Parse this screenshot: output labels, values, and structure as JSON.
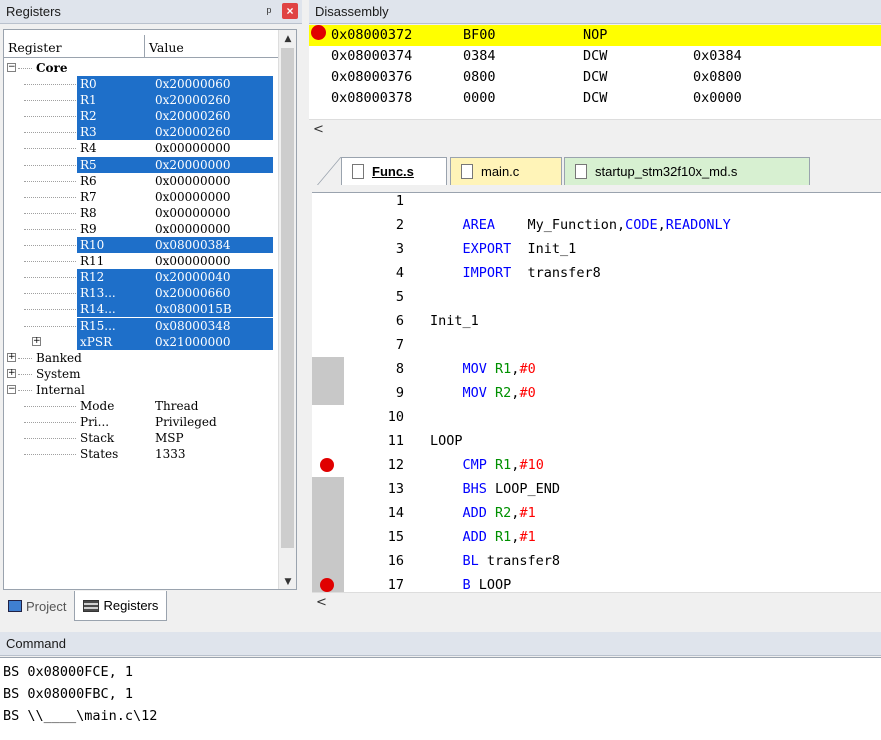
{
  "registers_panel": {
    "title": "Registers",
    "pin_icon": "pin-icon",
    "close_label": "×",
    "columns": [
      "Register",
      "Value"
    ],
    "rows": [
      {
        "name": "Core",
        "value": "",
        "level": 0,
        "expander": "−",
        "bold": true,
        "selected": false
      },
      {
        "name": "R0",
        "value": "0x20000060",
        "level": 1,
        "expander": "",
        "selected": true
      },
      {
        "name": "R1",
        "value": "0x20000260",
        "level": 1,
        "expander": "",
        "selected": true
      },
      {
        "name": "R2",
        "value": "0x20000260",
        "level": 1,
        "expander": "",
        "selected": true
      },
      {
        "name": "R3",
        "value": "0x20000260",
        "level": 1,
        "expander": "",
        "selected": true
      },
      {
        "name": "R4",
        "value": "0x00000000",
        "level": 1,
        "expander": "",
        "selected": false
      },
      {
        "name": "R5",
        "value": "0x20000000",
        "level": 1,
        "expander": "",
        "selected": true
      },
      {
        "name": "R6",
        "value": "0x00000000",
        "level": 1,
        "expander": "",
        "selected": false
      },
      {
        "name": "R7",
        "value": "0x00000000",
        "level": 1,
        "expander": "",
        "selected": false
      },
      {
        "name": "R8",
        "value": "0x00000000",
        "level": 1,
        "expander": "",
        "selected": false
      },
      {
        "name": "R9",
        "value": "0x00000000",
        "level": 1,
        "expander": "",
        "selected": false
      },
      {
        "name": "R10",
        "value": "0x08000384",
        "level": 1,
        "expander": "",
        "selected": true
      },
      {
        "name": "R11",
        "value": "0x00000000",
        "level": 1,
        "expander": "",
        "selected": false
      },
      {
        "name": "R12",
        "value": "0x20000040",
        "level": 1,
        "expander": "",
        "selected": true
      },
      {
        "name": "R13...",
        "value": "0x20000660",
        "level": 1,
        "expander": "",
        "selected": true
      },
      {
        "name": "R14...",
        "value": "0x0800015B",
        "level": 1,
        "expander": "",
        "selected": true
      },
      {
        "name": "R15...",
        "value": "0x08000348",
        "level": 1,
        "expander": "",
        "selected": true
      },
      {
        "name": "xPSR",
        "value": "0x21000000",
        "level": 1,
        "expander": "+",
        "selected": true
      },
      {
        "name": "Banked",
        "value": "",
        "level": 0,
        "expander": "+",
        "selected": false
      },
      {
        "name": "System",
        "value": "",
        "level": 0,
        "expander": "+",
        "selected": false
      },
      {
        "name": "Internal",
        "value": "",
        "level": 0,
        "expander": "−",
        "selected": false
      },
      {
        "name": "Mode",
        "value": "Thread",
        "level": 1,
        "expander": "",
        "selected": false
      },
      {
        "name": "Pri...",
        "value": "Privileged",
        "level": 1,
        "expander": "",
        "selected": false
      },
      {
        "name": "Stack",
        "value": "MSP",
        "level": 1,
        "expander": "",
        "selected": false
      },
      {
        "name": "States",
        "value": "1333",
        "level": 1,
        "expander": "",
        "selected": false
      }
    ],
    "tabs": [
      {
        "label": "Project",
        "icon": "project-icon",
        "active": false
      },
      {
        "label": "Registers",
        "icon": "registers-icon",
        "active": true
      }
    ]
  },
  "disassembly": {
    "title": "Disassembly",
    "rows": [
      {
        "addr": "0x08000372",
        "code": "BF00",
        "mnemonic": "NOP",
        "operand": "",
        "current": true,
        "breakpoint": true
      },
      {
        "addr": "0x08000374",
        "code": "0384",
        "mnemonic": "DCW",
        "operand": "0x0384",
        "current": false,
        "breakpoint": false
      },
      {
        "addr": "0x08000376",
        "code": "0800",
        "mnemonic": "DCW",
        "operand": "0x0800",
        "current": false,
        "breakpoint": false
      },
      {
        "addr": "0x08000378",
        "code": "0000",
        "mnemonic": "DCW",
        "operand": "0x0000",
        "current": false,
        "breakpoint": false
      }
    ],
    "scroll_left": "<"
  },
  "editor": {
    "tabs": [
      {
        "label": "Func.s",
        "active": true
      },
      {
        "label": "main.c",
        "active": false
      },
      {
        "label": "startup_stm32f10x_md.s",
        "active": false
      }
    ],
    "lines": [
      {
        "n": "1",
        "bp": false,
        "shade": false,
        "parts": []
      },
      {
        "n": "2",
        "bp": false,
        "shade": false,
        "parts": [
          {
            "t": "    AREA    ",
            "c": "kw"
          },
          {
            "t": "My_Function,",
            "c": "tx"
          },
          {
            "t": "CODE",
            "c": "kw"
          },
          {
            "t": ",",
            "c": "tx"
          },
          {
            "t": "READONLY",
            "c": "kw"
          }
        ]
      },
      {
        "n": "3",
        "bp": false,
        "shade": false,
        "parts": [
          {
            "t": "    EXPORT  ",
            "c": "kw"
          },
          {
            "t": "Init_1",
            "c": "tx"
          }
        ]
      },
      {
        "n": "4",
        "bp": false,
        "shade": false,
        "parts": [
          {
            "t": "    IMPORT  ",
            "c": "kw"
          },
          {
            "t": "transfer8",
            "c": "tx"
          }
        ]
      },
      {
        "n": "5",
        "bp": false,
        "shade": false,
        "parts": []
      },
      {
        "n": "6",
        "bp": false,
        "shade": false,
        "parts": [
          {
            "t": "Init_1",
            "c": "tx"
          }
        ]
      },
      {
        "n": "7",
        "bp": false,
        "shade": false,
        "parts": []
      },
      {
        "n": "8",
        "bp": false,
        "shade": true,
        "parts": [
          {
            "t": "    MOV ",
            "c": "kw"
          },
          {
            "t": "R1",
            "c": "rg"
          },
          {
            "t": ",",
            "c": "tx"
          },
          {
            "t": "#0",
            "c": "nm"
          }
        ]
      },
      {
        "n": "9",
        "bp": false,
        "shade": true,
        "parts": [
          {
            "t": "    MOV ",
            "c": "kw"
          },
          {
            "t": "R2",
            "c": "rg"
          },
          {
            "t": ",",
            "c": "tx"
          },
          {
            "t": "#0",
            "c": "nm"
          }
        ]
      },
      {
        "n": "10",
        "bp": false,
        "shade": false,
        "parts": []
      },
      {
        "n": "11",
        "bp": false,
        "shade": false,
        "parts": [
          {
            "t": "LOOP",
            "c": "tx"
          }
        ]
      },
      {
        "n": "12",
        "bp": true,
        "shade": false,
        "parts": [
          {
            "t": "    CMP ",
            "c": "kw"
          },
          {
            "t": "R1",
            "c": "rg"
          },
          {
            "t": ",",
            "c": "tx"
          },
          {
            "t": "#10",
            "c": "nm"
          }
        ]
      },
      {
        "n": "13",
        "bp": false,
        "shade": true,
        "parts": [
          {
            "t": "    BHS ",
            "c": "kw"
          },
          {
            "t": "LOOP_END",
            "c": "tx"
          }
        ]
      },
      {
        "n": "14",
        "bp": false,
        "shade": true,
        "parts": [
          {
            "t": "    ADD ",
            "c": "kw"
          },
          {
            "t": "R2",
            "c": "rg"
          },
          {
            "t": ",",
            "c": "tx"
          },
          {
            "t": "#1",
            "c": "nm"
          }
        ]
      },
      {
        "n": "15",
        "bp": false,
        "shade": true,
        "parts": [
          {
            "t": "    ADD ",
            "c": "kw"
          },
          {
            "t": "R1",
            "c": "rg"
          },
          {
            "t": ",",
            "c": "tx"
          },
          {
            "t": "#1",
            "c": "nm"
          }
        ]
      },
      {
        "n": "16",
        "bp": false,
        "shade": true,
        "parts": [
          {
            "t": "    BL ",
            "c": "kw"
          },
          {
            "t": "transfer8",
            "c": "tx"
          }
        ]
      },
      {
        "n": "17",
        "bp": true,
        "shade": true,
        "parts": [
          {
            "t": "    B ",
            "c": "kw"
          },
          {
            "t": "LOOP",
            "c": "tx"
          }
        ]
      }
    ],
    "scroll_left": "<"
  },
  "command": {
    "title": "Command",
    "lines": [
      "BS 0x08000FCE, 1",
      "BS 0x08000FBC, 1",
      "BS \\\\____\\main.c\\12"
    ]
  }
}
